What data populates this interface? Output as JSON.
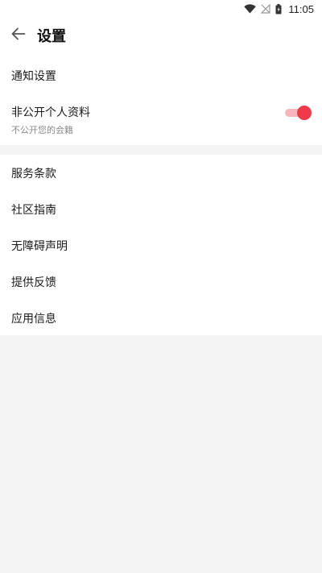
{
  "status_bar": {
    "time": "11:05",
    "icons": [
      "wifi-icon",
      "signal-off-icon",
      "battery-icon"
    ]
  },
  "header": {
    "back_icon": "back-arrow-icon",
    "title": "设置"
  },
  "section_privacy": {
    "notify_label": "通知设置",
    "private_profile": {
      "label": "非公开个人资料",
      "sublabel": "不公开您的会籍",
      "toggle_on": true,
      "accent_color": "#f0394b"
    }
  },
  "section_info": {
    "items": [
      {
        "label": "服务条款"
      },
      {
        "label": "社区指南"
      },
      {
        "label": "无障碍声明"
      },
      {
        "label": "提供反馈"
      },
      {
        "label": "应用信息"
      }
    ]
  }
}
